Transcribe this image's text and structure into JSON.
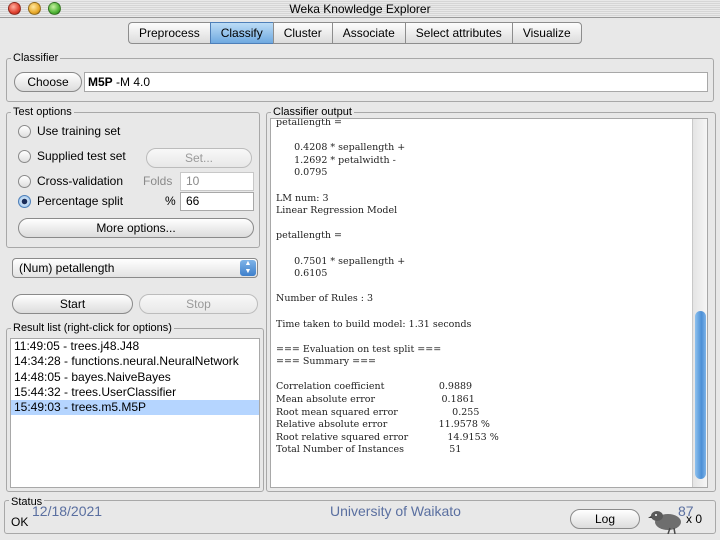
{
  "window": {
    "title": "Weka Knowledge Explorer"
  },
  "tabs": [
    "Preprocess",
    "Classify",
    "Cluster",
    "Associate",
    "Select attributes",
    "Visualize"
  ],
  "classifier": {
    "section_label": "Classifier",
    "choose_label": "Choose",
    "name": "M5P",
    "options": "-M 4.0"
  },
  "test_options": {
    "section_label": "Test options",
    "use_training_set": "Use training set",
    "supplied_test_set": "Supplied test set",
    "set_label": "Set...",
    "cross_validation": "Cross-validation",
    "folds_label": "Folds",
    "folds_value": "10",
    "percentage_split": "Percentage split",
    "percent_symbol": "%",
    "percent_value": "66",
    "more_options": "More options...",
    "selected": "percentage_split"
  },
  "target_attribute": "(Num) petallength",
  "actions": {
    "start": "Start",
    "stop": "Stop"
  },
  "result_list": {
    "section_label": "Result list (right-click for options)",
    "items": [
      "11:49:05 - trees.j48.J48",
      "14:34:28 - functions.neural.NeuralNetwork",
      "14:48:05 - bayes.NaiveBayes",
      "15:44:32 - trees.UserClassifier",
      "15:49:03 - trees.m5.M5P"
    ],
    "selected_index": 4
  },
  "classifier_output": {
    "section_label": "Classifier output",
    "text": "petallength =\n\n      0.4208 * sepallength +\n      1.2692 * petalwidth -\n      0.0795\n\nLM num: 3\nLinear Regression Model\n\npetallength =\n\n      0.7501 * sepallength +\n      0.6105\n\nNumber of Rules : 3\n\nTime taken to build model: 1.31 seconds\n\n=== Evaluation on test split ===\n=== Summary ===\n\nCorrelation coefficient                  0.9889\nMean absolute error                      0.1861\nRoot mean squared error                  0.255\nRelative absolute error                 11.9578 %\nRoot relative squared error             14.9153 %\nTotal Number of Instances               51"
  },
  "status": {
    "section_label": "Status",
    "text": "OK",
    "log_label": "Log",
    "instances": "x 0"
  },
  "footer": {
    "date": "12/18/2021",
    "org": "University of Waikato",
    "page": "87"
  },
  "colors": {
    "accent": "#5b9be0",
    "selection": "#b5d5ff"
  }
}
